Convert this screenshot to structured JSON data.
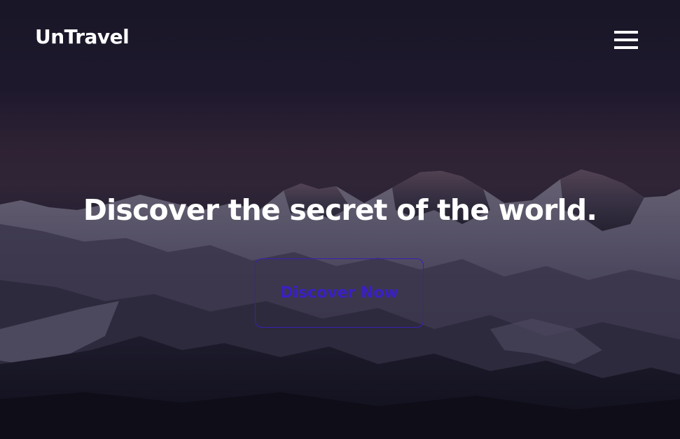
{
  "brand": {
    "name": "UnTravel"
  },
  "nav": {
    "menu_icon": "hamburger-menu-icon"
  },
  "hero": {
    "headline": "Discover the secret of the world.",
    "cta_label": "Discover Now"
  },
  "colors": {
    "text_primary": "#ffffff",
    "cta_accent": "#3a1fc4",
    "background_dark": "#1a1628"
  }
}
